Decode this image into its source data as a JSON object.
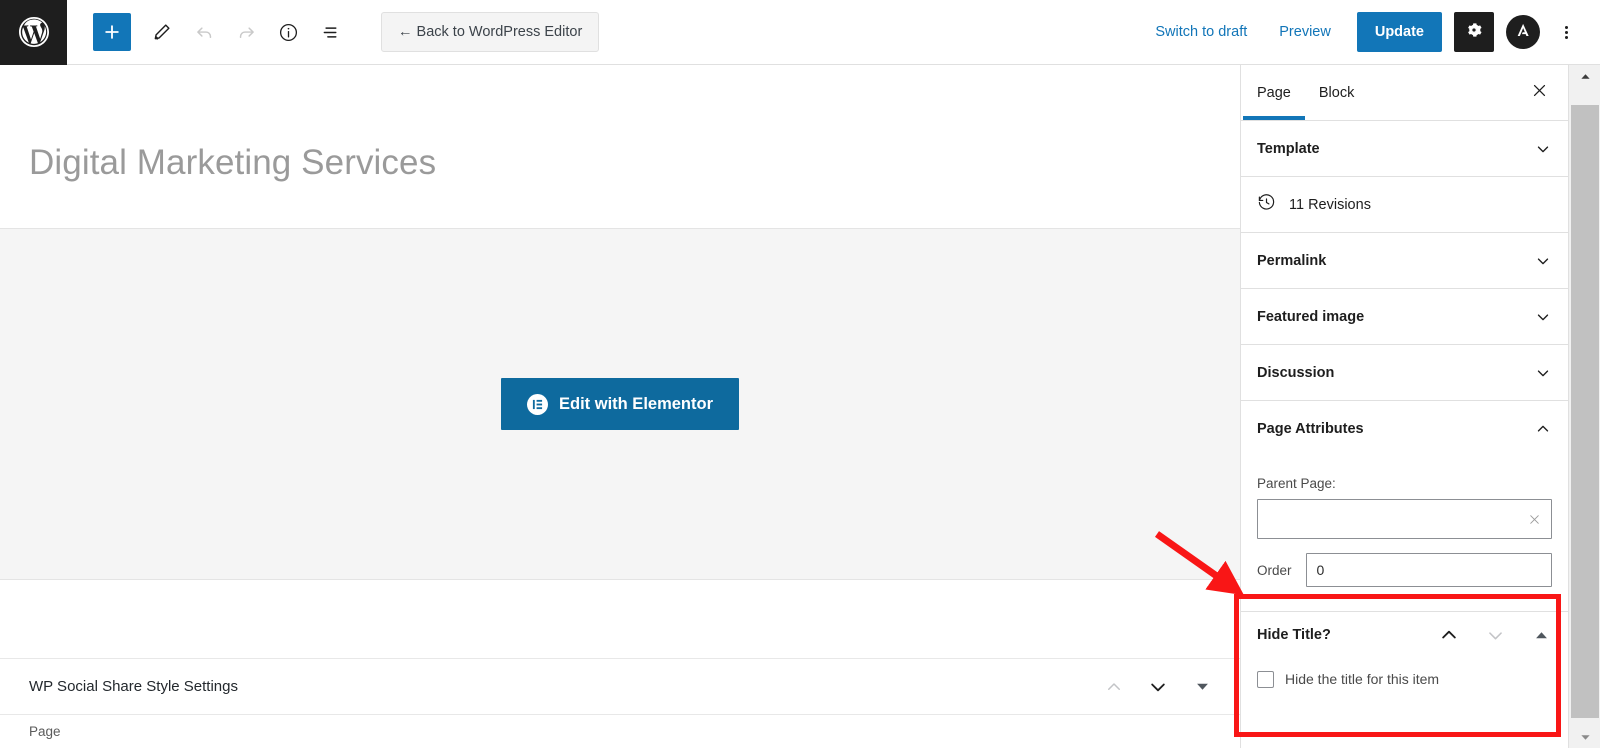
{
  "topbar": {
    "logo_icon": "wordpress-logo-icon",
    "left_tools": [
      {
        "name": "add-block-button",
        "icon": "plus-icon",
        "label": "+"
      },
      {
        "name": "edit-tool-button",
        "icon": "pencil-icon",
        "label": ""
      },
      {
        "name": "undo-button",
        "icon": "undo-arrow-icon",
        "label": "",
        "disabled": true
      },
      {
        "name": "redo-button",
        "icon": "redo-arrow-icon",
        "label": "",
        "disabled": true
      },
      {
        "name": "details-button",
        "icon": "info-circle-icon",
        "label": ""
      },
      {
        "name": "list-view-button",
        "icon": "list-view-icon",
        "label": ""
      }
    ],
    "back_button": "← Back to WordPress Editor",
    "switch_to_draft": "Switch to draft",
    "preview": "Preview",
    "update": "Update",
    "settings_icon": "gear-icon",
    "avatar_icon": "astra-avatar-icon",
    "options_icon": "kebab-menu-icon",
    "accent_blue": "#1276b8",
    "dark": "#1e1e1e"
  },
  "editor": {
    "post_title": "Digital Marketing Services",
    "elementor_button": "Edit with Elementor",
    "elementor_button_color": "#0e6a9e",
    "elementor_icon": "elementor-logo-icon",
    "metabox_title": "WP Social Share Style Settings",
    "metabox_controls": [
      {
        "name": "move-up-icon",
        "glyph": "∧",
        "state": "disabled"
      },
      {
        "name": "move-down-icon",
        "glyph": "∨",
        "state": "enabled"
      },
      {
        "name": "toggle-panel-icon",
        "glyph": "▼",
        "state": "enabled"
      }
    ],
    "footer_label": "Page"
  },
  "sidebar": {
    "tabs": [
      {
        "label": "Page",
        "active": true
      },
      {
        "label": "Block",
        "active": false
      }
    ],
    "close_icon": "close-icon",
    "panels": [
      {
        "label": "Template",
        "icon": "chevron-down-icon",
        "expanded": false
      },
      {
        "label": "11 Revisions",
        "icon": "revisions-clock-icon",
        "type": "link"
      },
      {
        "label": "Permalink",
        "icon": "chevron-down-icon",
        "expanded": false
      },
      {
        "label": "Featured image",
        "icon": "chevron-down-icon",
        "expanded": false
      },
      {
        "label": "Discussion",
        "icon": "chevron-down-icon",
        "expanded": false
      },
      {
        "label": "Page Attributes",
        "icon": "chevron-up-icon",
        "expanded": true
      }
    ],
    "page_attributes": {
      "parent_page_label": "Parent Page:",
      "parent_page_value": "",
      "parent_page_clear_icon": "clear-x-icon",
      "order_label": "Order",
      "order_value": "0"
    },
    "hide_title": {
      "heading": "Hide Title?",
      "controls": [
        {
          "name": "move-up-icon",
          "glyph": "∧",
          "state": "enabled"
        },
        {
          "name": "move-down-icon",
          "glyph": "∨",
          "state": "disabled"
        },
        {
          "name": "toggle-panel-icon",
          "glyph": "▲",
          "state": "enabled"
        }
      ],
      "checkbox_label": "Hide the title for this item",
      "checked": false
    }
  },
  "annotation": {
    "highlight_color": "#f91616",
    "box_target": "hide-title-panel",
    "arrow": "points-to-hide-title-panel"
  }
}
